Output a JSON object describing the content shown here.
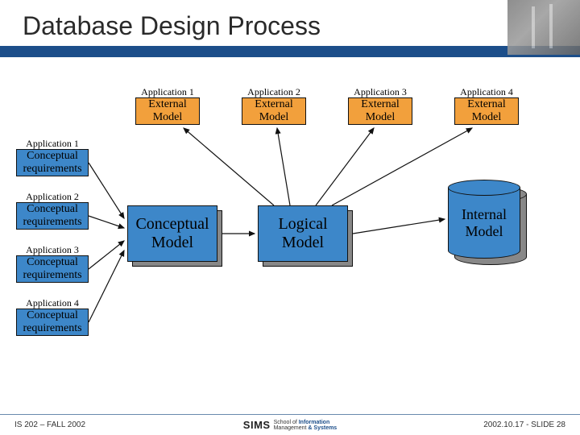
{
  "title": "Database Design Process",
  "apps": [
    {
      "label": "Application 1",
      "box": "External\nModel"
    },
    {
      "label": "Application 2",
      "box": "External\nModel"
    },
    {
      "label": "Application 3",
      "box": "External\nModel"
    },
    {
      "label": "Application 4",
      "box": "External\nModel"
    }
  ],
  "reqs": [
    {
      "label": "Application 1",
      "box": "Conceptual\nrequirements"
    },
    {
      "label": "Application 2",
      "box": "Conceptual\nrequirements"
    },
    {
      "label": "Application 3",
      "box": "Conceptual\nrequirements"
    },
    {
      "label": "Application 4",
      "box": "Conceptual\nrequirements"
    }
  ],
  "stages": {
    "conceptual": "Conceptual\nModel",
    "logical": "Logical\nModel",
    "internal": "Internal\nModel"
  },
  "footer": {
    "left": "IS 202 – FALL 2002",
    "right": "2002.10.17 - SLIDE 28",
    "logo": "SIMS",
    "logo_sub1": "School of",
    "logo_sub2": "Information",
    "logo_sub3": "Management",
    "logo_sub4": "& Systems"
  }
}
